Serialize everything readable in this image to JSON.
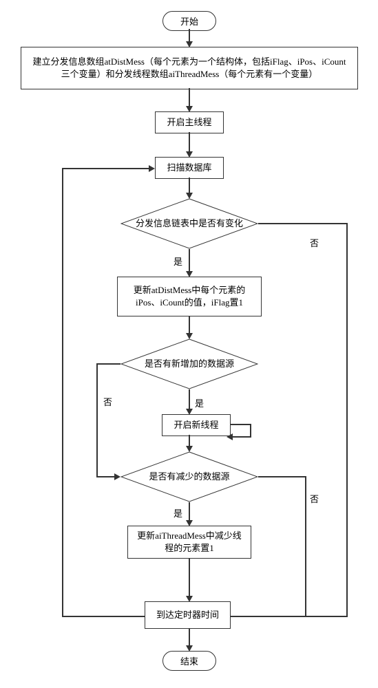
{
  "terminator_start": "开始",
  "terminator_end": "结束",
  "process_init": "建立分发信息数组atDistMess（每个元素为一个结构体，包括iFlag、iPos、iCount 三个变量）和分发线程数组aiThreadMess（每个元素有一个变量）",
  "process_main_thread": "开启主线程",
  "process_scan_db": "扫描数据库",
  "decision_list_changed": "分发信息链表中是否有变化",
  "process_update_dist": "更新atDistMess中每个元素的iPos、iCount的值，iFlag置1",
  "decision_new_source": "是否有新增加的数据源",
  "process_new_thread": "开启新线程",
  "decision_less_source": "是否有减少的数据源",
  "process_update_thread": "更新aiThreadMess中减少线程的元素置1",
  "process_timer": "到达定时器时间",
  "label_yes": "是",
  "label_no": "否"
}
